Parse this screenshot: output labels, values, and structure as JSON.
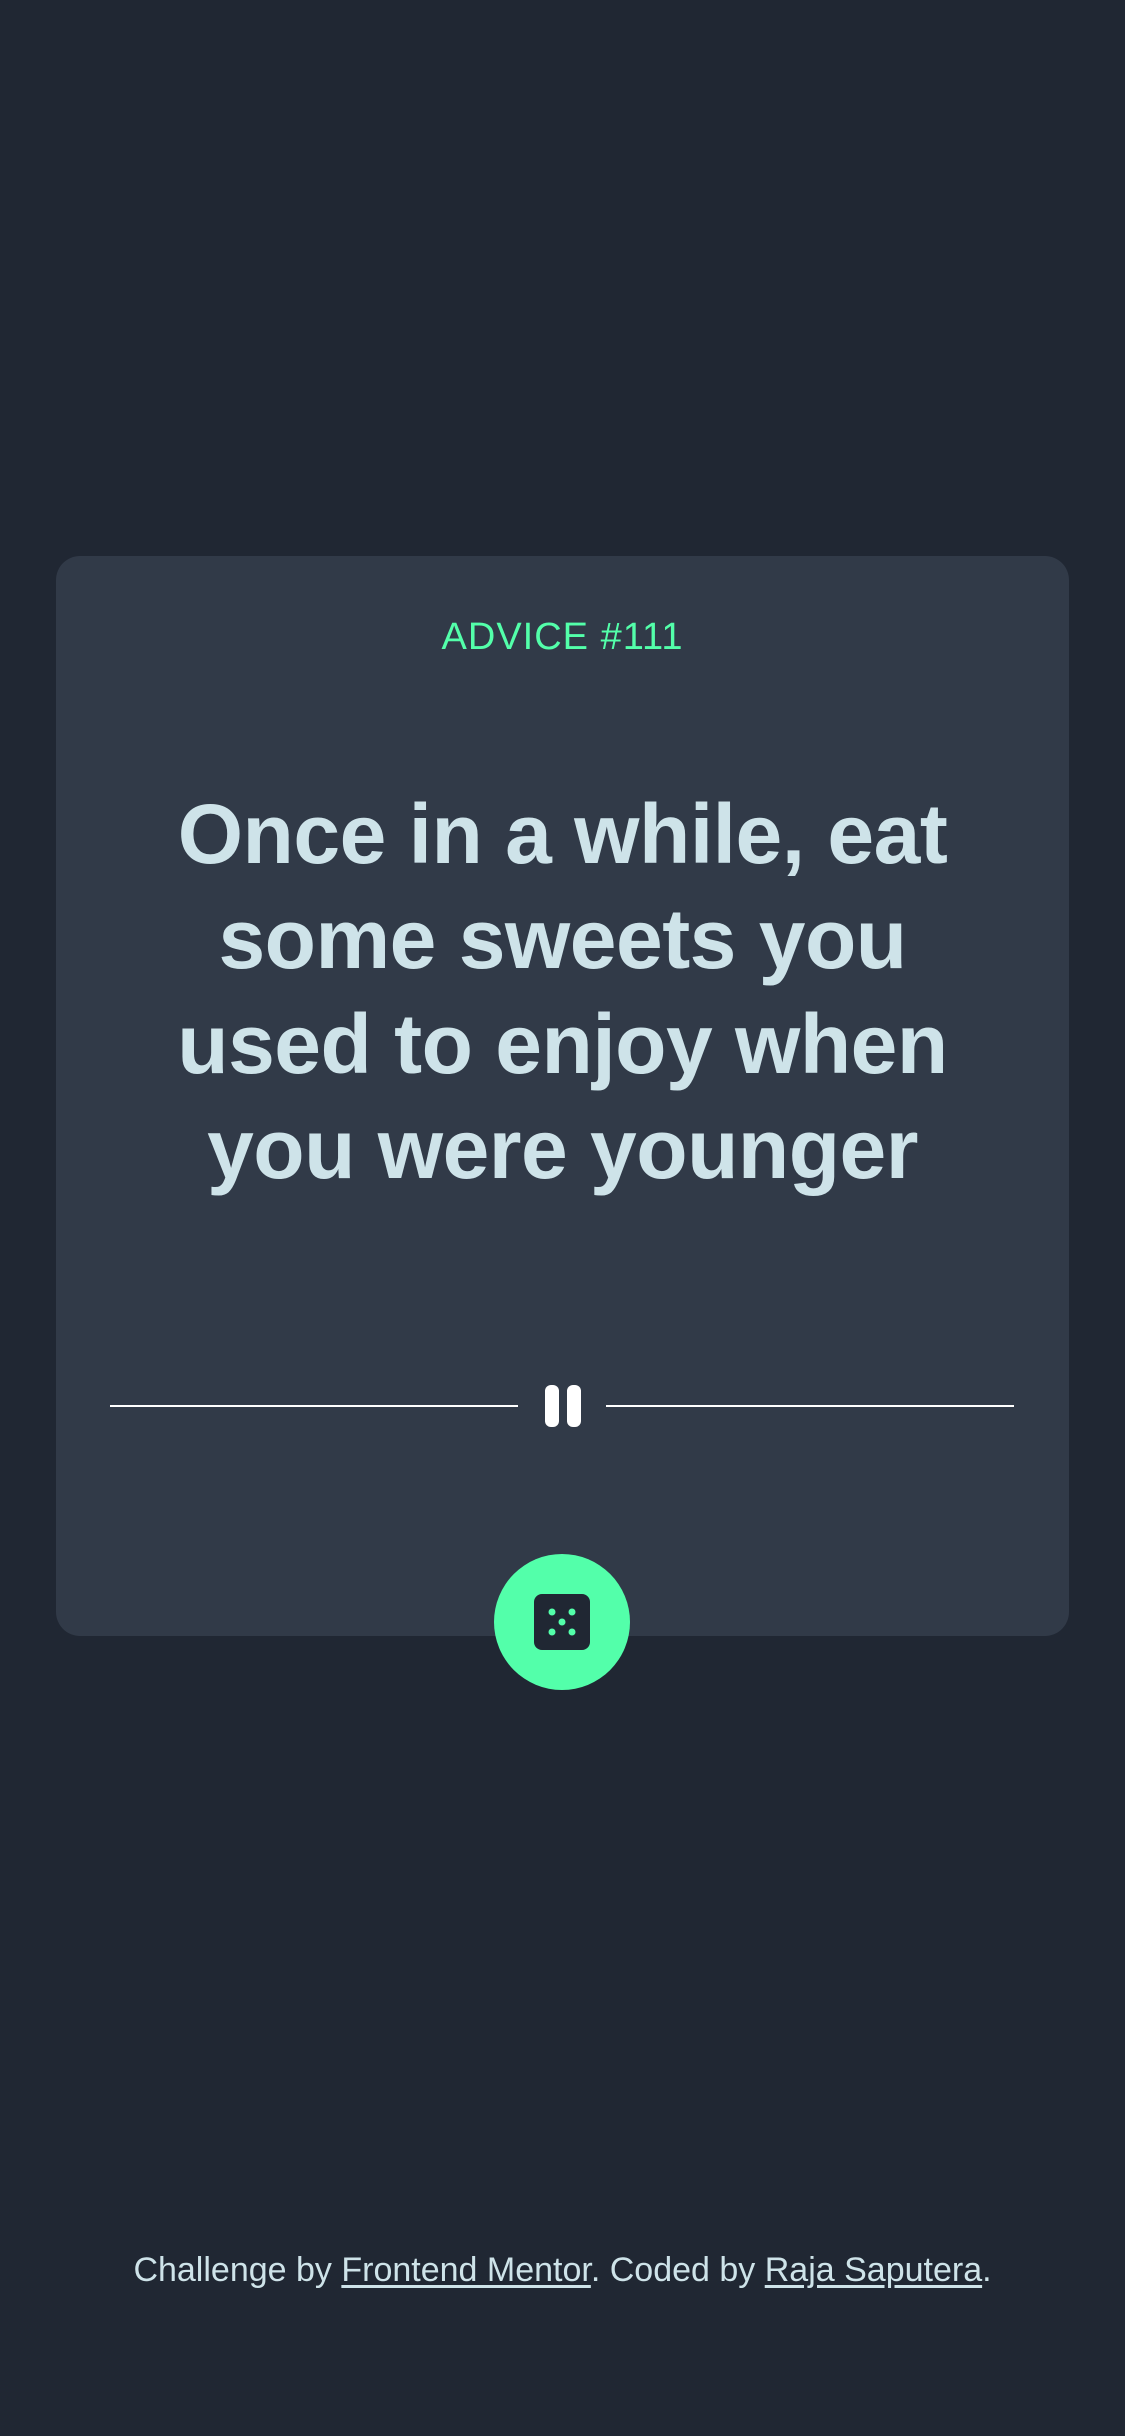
{
  "advice": {
    "label": "ADVICE #111",
    "quote": "Once in a while, eat some sweets you used to enjoy when you were younger"
  },
  "footer": {
    "challenge_prefix": "Challenge by ",
    "challenge_link": "Frontend Mentor",
    "middle": ". Coded by ",
    "author_link": "Raja Saputera",
    "suffix": "."
  },
  "icons": {
    "divider": "pause-icon",
    "button": "dice-icon"
  },
  "colors": {
    "background": "#202733",
    "card": "#313a48",
    "accent": "#53ffaa",
    "text": "#cee3e9"
  }
}
